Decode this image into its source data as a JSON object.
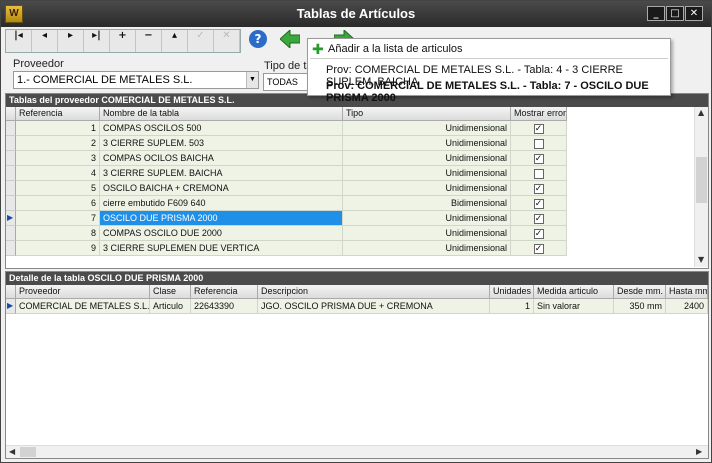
{
  "window": {
    "title": "Tablas de Artículos",
    "app_icon_text": "W"
  },
  "toolbar": {
    "nav_buttons": [
      "|◂",
      "◂",
      "▸",
      "▸|",
      "+",
      "−",
      "▴",
      "✓",
      "✕"
    ],
    "help_icon": "?",
    "back_icon": "green-left-arrow",
    "forward_icon": "green-right-arrow"
  },
  "filters": {
    "proveedor_label": "Proveedor",
    "proveedor_value": "1.- COMERCIAL DE METALES S.L.",
    "tipo_label": "Tipo de tab",
    "tipo_value": "TODAS"
  },
  "popup_menu": {
    "add_label": "Añadir a la lista de articulos",
    "items": [
      "Prov: COMERCIAL DE METALES S.L. - Tabla: 4 - 3 CIERRE SUPLEM. BAICHA",
      "Prov: COMERCIAL DE METALES S.L. - Tabla: 7 - OSCILO DUE PRISMA 2000"
    ]
  },
  "tables_panel": {
    "header": "Tablas del proveedor COMERCIAL DE METALES S.L.",
    "columns": [
      "Referencia",
      "Nombre de la tabla",
      "Tipo",
      "Mostrar error"
    ],
    "rows": [
      {
        "ref": "1",
        "name": "COMPAS OSCILOS 500",
        "tipo": "Unidimensional",
        "error": true
      },
      {
        "ref": "2",
        "name": "3 CIERRE SUPLEM. 503",
        "tipo": "Unidimensional",
        "error": false
      },
      {
        "ref": "3",
        "name": "COMPAS OCILOS BAICHA",
        "tipo": "Unidimensional",
        "error": true
      },
      {
        "ref": "4",
        "name": "3 CIERRE SUPLEM. BAICHA",
        "tipo": "Unidimensional",
        "error": false
      },
      {
        "ref": "5",
        "name": "OSCILO BAICHA + CREMONA",
        "tipo": "Unidimensional",
        "error": true
      },
      {
        "ref": "6",
        "name": "cierre embutido F609 640",
        "tipo": "Bidimensional",
        "error": true
      },
      {
        "ref": "7",
        "name": "OSCILO DUE PRISMA 2000",
        "tipo": "Unidimensional",
        "error": true
      },
      {
        "ref": "8",
        "name": "COMPAS OSCILO DUE 2000",
        "tipo": "Unidimensional",
        "error": true
      },
      {
        "ref": "9",
        "name": "3 CIERRE SUPLEMEN DUE VERTICA",
        "tipo": "Unidimensional",
        "error": true
      }
    ],
    "selected_index": 6
  },
  "detail_panel": {
    "header": "Detalle de la tabla OSCILO DUE PRISMA 2000",
    "columns": [
      "Proveedor",
      "Clase",
      "Referencia",
      "Descripcion",
      "Unidades",
      "Medida articulo",
      "Desde mm.",
      "Hasta mm"
    ],
    "rows": [
      {
        "proveedor": "COMERCIAL DE METALES S.L.",
        "clase": "Articulo",
        "referencia": "22643390",
        "descripcion": "JGO. OSCILO PRISMA DUE + CREMONA",
        "unidades": "1",
        "medida": "Sin valorar",
        "desde": "350 mm",
        "hasta": "2400"
      }
    ]
  },
  "colors": {
    "title_bg": "#2e2e2e",
    "panel_header_bg": "#4b4b4b",
    "row_bg": "#eef3e6",
    "selected_bg": "#1f8fe8"
  }
}
